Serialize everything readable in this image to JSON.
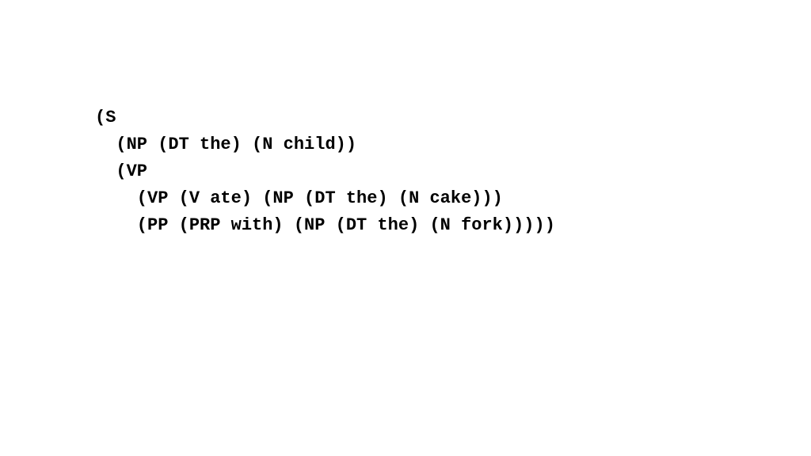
{
  "parse_tree": {
    "lines": [
      "(S",
      "  (NP (DT the) (N child))",
      "  (VP",
      "    (VP (V ate) (NP (DT the) (N cake)))",
      "    (PP (PRP with) (NP (DT the) (N fork)))))"
    ]
  }
}
